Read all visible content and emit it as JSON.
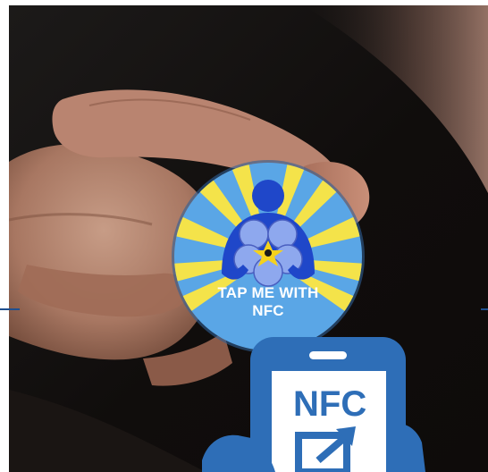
{
  "photo": {
    "subject": "hand-holding-nfc-badge"
  },
  "badge": {
    "line1": "TAP ME WITH",
    "line2": "NFC",
    "colors": {
      "disc": "#5aa6e6",
      "rays": "#f4e34a",
      "figure": "#1f47c9",
      "flower": "#8ea8ee",
      "flower_center": "#f5d21c"
    }
  },
  "nfc_icon": {
    "label": "NFC",
    "icon": "nfc-phone-icon",
    "colors": {
      "phone": "#2e6eb7",
      "hand": "#2e6eb7",
      "screen": "#ffffff"
    }
  },
  "rule_color": "#1f4f8f"
}
